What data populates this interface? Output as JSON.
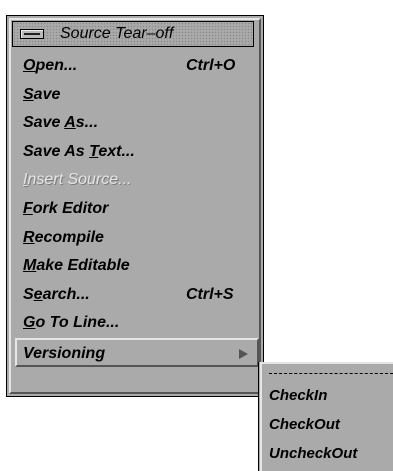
{
  "menu": {
    "title": "Source Tear–off",
    "items": [
      {
        "pre": "",
        "mn": "O",
        "post": "pen...",
        "accel": "Ctrl+O",
        "disabled": false
      },
      {
        "pre": "",
        "mn": "S",
        "post": "ave",
        "accel": "",
        "disabled": false
      },
      {
        "pre": "Save ",
        "mn": "A",
        "post": "s...",
        "accel": "",
        "disabled": false
      },
      {
        "pre": "Save As ",
        "mn": "T",
        "post": "ext...",
        "accel": "",
        "disabled": false
      },
      {
        "pre": "",
        "mn": "I",
        "post": "nsert Source...",
        "accel": "",
        "disabled": true
      },
      {
        "pre": "",
        "mn": "F",
        "post": "ork Editor",
        "accel": "",
        "disabled": false
      },
      {
        "pre": "",
        "mn": "R",
        "post": "ecompile",
        "accel": "",
        "disabled": false
      },
      {
        "pre": "",
        "mn": "M",
        "post": "ake Editable",
        "accel": "",
        "disabled": false
      },
      {
        "pre": "S",
        "mn": "e",
        "post": "arch...",
        "accel": "Ctrl+S",
        "disabled": false
      },
      {
        "pre": "",
        "mn": "G",
        "post": "o To Line...",
        "accel": "",
        "disabled": false
      },
      {
        "pre": "Versioning",
        "mn": "",
        "post": "",
        "accel": "",
        "disabled": false
      }
    ]
  },
  "submenu": {
    "items": [
      "CheckIn",
      "CheckOut",
      "UncheckOut"
    ]
  }
}
